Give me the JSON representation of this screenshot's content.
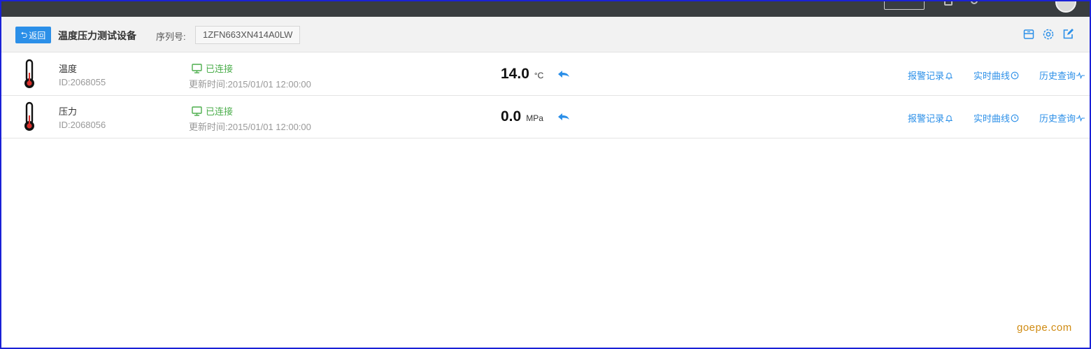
{
  "colors": {
    "accent": "#2b8fe8",
    "connected": "#4cae4c",
    "topbar": "#393d40",
    "header": "#f2f2f2",
    "frame": "#1a21d6",
    "watermark": "#d08b12"
  },
  "header": {
    "back_label": "返回",
    "back_icon": "return-arrow-icon",
    "device_title": "温度压力测试设备",
    "serial_label": "序列号:",
    "serial_value": "1ZFN663XN414A0LW",
    "icons": [
      "storage-icon",
      "gear-icon",
      "edit-icon"
    ]
  },
  "devices": [
    {
      "name": "温度",
      "id": "ID:2068055",
      "status": "已连接",
      "updated": "更新时间:2015/01/01 12:00:00",
      "value": "14.0",
      "unit": "°C",
      "icon": "thermometer-icon",
      "links": [
        "报警记录",
        "实时曲线",
        "历史查询"
      ]
    },
    {
      "name": "压力",
      "id": "ID:2068056",
      "status": "已连接",
      "updated": "更新时间:2015/01/01 12:00:00",
      "value": "0.0",
      "unit": "MPa",
      "icon": "thermometer-icon",
      "links": [
        "报警记录",
        "实时曲线",
        "历史查询"
      ]
    }
  ],
  "watermark": "goepe.com"
}
